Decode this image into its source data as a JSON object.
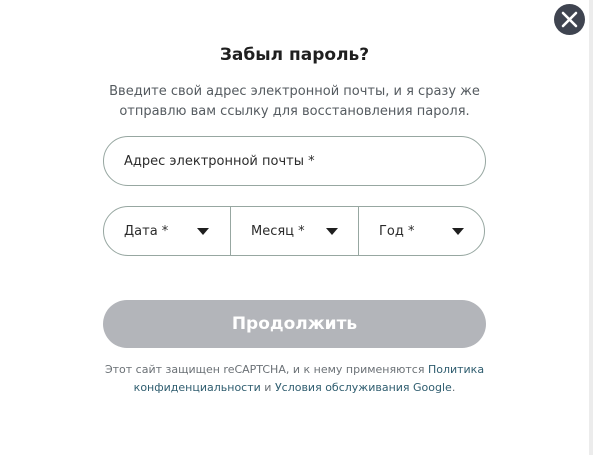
{
  "dialog": {
    "title": "Забыл пароль?",
    "description_line1": "Введите свой адрес электронной почты, и я сразу же",
    "description_line2": "отправлю вам ссылку для восстановления пароля.",
    "close_icon": "close-icon"
  },
  "form": {
    "email_placeholder": "Адрес электронной почты *",
    "day_label": "Дата *",
    "month_label": "Месяц *",
    "year_label": "Год *",
    "submit_label": "Продолжить",
    "caret_icon": "caret-down-icon"
  },
  "legal": {
    "prefix": "Этот сайт защищен reCAPTCHA, и к нему применяются ",
    "privacy_link_part1": "Политика",
    "privacy_link_part2": "конфиденциальности",
    "connector": " и ",
    "terms_link": "Условия обслуживания Google",
    "suffix": "."
  },
  "colors": {
    "close_button": "#3f4450",
    "border": "#97a7a1",
    "submit_disabled": "#b3b5ba",
    "link": "#2f5d6f"
  }
}
